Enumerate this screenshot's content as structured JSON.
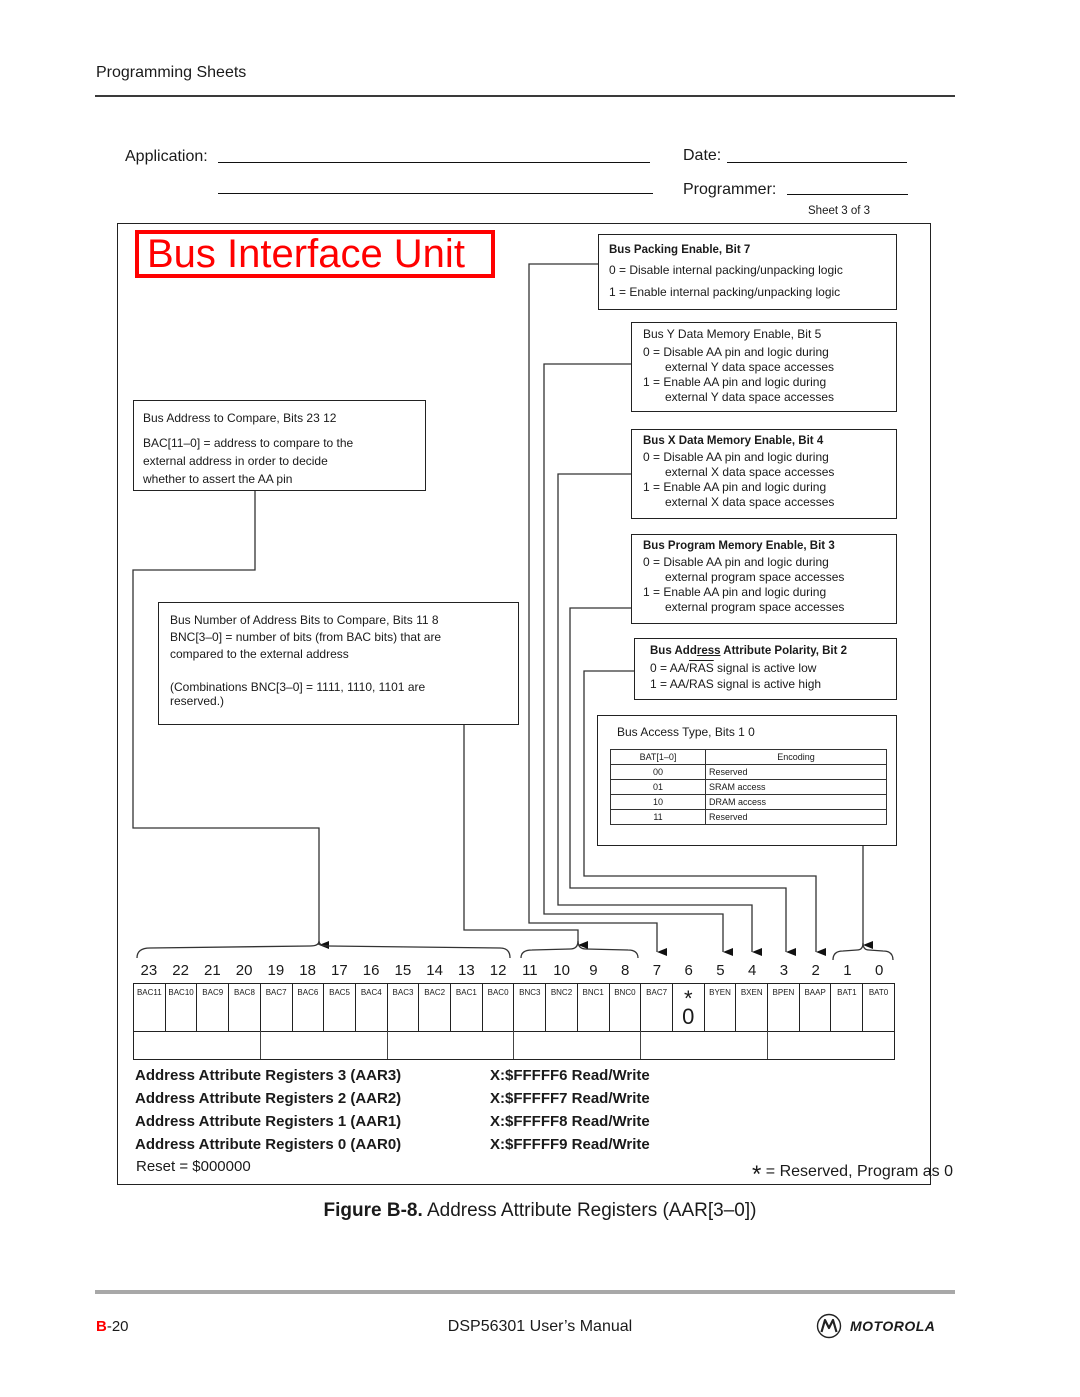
{
  "header": {
    "section": "Programming Sheets",
    "application_label": "Application:",
    "date_label": "Date:",
    "programmer_label": "Programmer:",
    "sheet": "Sheet 3 of 3"
  },
  "banner": {
    "title": "Bus Interface Unit",
    "color": "#ff0000"
  },
  "descriptions": {
    "bpac": {
      "title": "Bus Packing Enable, Bit 7",
      "lines": [
        "0 = Disable internal packing/unpacking logic",
        "1 = Enable internal packing/unpacking logic"
      ]
    },
    "byen": {
      "title": "Bus Y Data Memory Enable, Bit 5",
      "l0a": "0 = Disable AA pin and logic during",
      "l0b": "external Y data space accesses",
      "l1a": "1 = Enable AA pin and logic during",
      "l1b": "external Y data space accesses"
    },
    "bxen": {
      "title": "Bus X Data Memory Enable, Bit 4",
      "l0a": "0 = Disable AA pin and logic during",
      "l0b": "external X data space accesses",
      "l1a": "1 = Enable AA pin and logic during",
      "l1b": "external X data space accesses"
    },
    "bpen": {
      "title": "Bus Program Memory Enable, Bit 3",
      "l0a": "0 = Disable AA pin and logic during",
      "l0b": "external program space accesses",
      "l1a": "1 = Enable AA pin and logic during",
      "l1b": "external program space accesses"
    },
    "baap": {
      "title_a": "Bus Add",
      "title_b": "ress",
      "title_c": " Attribute Polarity, Bit 2",
      "l0_pre": "0 = AA/",
      "l0_sig": "RAS",
      "l0_post": " signal is active low",
      "l1_pre": "1 = AA/",
      "l1_sig": "RAS",
      "l1_post": " signal is active high"
    },
    "bat": {
      "title": "Bus Access Type, Bits 1 0",
      "headers": [
        "BAT[1–0]",
        "Encoding"
      ],
      "rows": [
        [
          "00",
          "Reserved"
        ],
        [
          "01",
          "SRAM access"
        ],
        [
          "10",
          "DRAM access"
        ],
        [
          "11",
          "Reserved"
        ]
      ]
    },
    "bac": {
      "title": "Bus Address to Compare, Bits 23 12",
      "lines": [
        "BAC[11–0] = address to compare to the",
        "external address in order to decide",
        "whether to assert the AA pin"
      ]
    },
    "bnc": {
      "title": "Bus Number of Address Bits to Compare, Bits 11 8",
      "lines": [
        "BNC[3–0] = number of bits (from BAC bits) that are",
        "compared to the external address"
      ],
      "note": [
        "(Combinations BNC[3–0] = 1111, 1110, 1101 are",
        "reserved.)"
      ]
    }
  },
  "register": {
    "bit_numbers": [
      "23",
      "22",
      "21",
      "20",
      "19",
      "18",
      "17",
      "16",
      "15",
      "14",
      "13",
      "12",
      "11",
      "10",
      "9",
      "8",
      "7",
      "6",
      "5",
      "4",
      "3",
      "2",
      "1",
      "0"
    ],
    "fields": [
      "BAC11",
      "BAC10",
      "BAC9",
      "BAC8",
      "BAC7",
      "BAC6",
      "BAC5",
      "BAC4",
      "BAC3",
      "BAC2",
      "BAC1",
      "BAC0",
      "BNC3",
      "BNC2",
      "BNC1",
      "BNC0",
      "BAC7",
      "*",
      "BYEN",
      "BXEN",
      "BPEN",
      "BAAP",
      "BAT1",
      "BAT0"
    ],
    "reserved_value": "0",
    "names": [
      {
        "name": "Address Attribute Registers 3 (AAR3)",
        "addr": "X:$FFFFF6 Read/Write"
      },
      {
        "name": "Address Attribute Registers 2 (AAR2)",
        "addr": "X:$FFFFF7 Read/Write"
      },
      {
        "name": "Address Attribute Registers 1 (AAR1)",
        "addr": "X:$FFFFF8 Read/Write"
      },
      {
        "name": "Address Attribute Registers 0 (AAR0)",
        "addr": "X:$FFFFF9 Read/Write"
      }
    ],
    "reset": "Reset = $000000",
    "reserved_note_star": "*",
    "reserved_note": "= Reserved, Program as 0"
  },
  "caption": {
    "label": "Figure B-8.",
    "text": " Address Attribute Registers (AAR[3–0])"
  },
  "footer": {
    "page_letter": "B",
    "page_number": "-20",
    "page_letter_color": "#ff0000",
    "manual": "DSP56301 User’s Manual",
    "brand": "MOTOROLA",
    "brand_icon": "motorola-logo-icon"
  }
}
